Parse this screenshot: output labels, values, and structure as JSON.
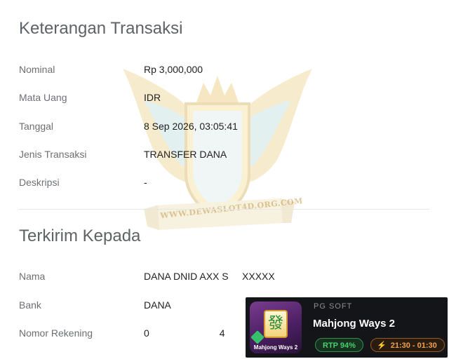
{
  "transaction": {
    "title": "Keterangan Transaksi",
    "rows": [
      {
        "label": "Nominal",
        "value": "Rp 3,000,000"
      },
      {
        "label": "Mata Uang",
        "value": "IDR"
      },
      {
        "label": "Tanggal",
        "value": "8 Sep 2026, 03:05:41"
      },
      {
        "label": "Jenis Transaksi",
        "value": "TRANSFER DANA"
      },
      {
        "label": "Deskripsi",
        "value": "-"
      }
    ]
  },
  "recipient": {
    "title": "Terkirim Kepada",
    "rows": [
      {
        "label": "Nama",
        "value": "DANA DNID AXX S     XXXXX"
      },
      {
        "label": "Bank",
        "value": "DANA"
      },
      {
        "label": "Nomor Rekening",
        "value_start": "0",
        "value_end": "4"
      }
    ]
  },
  "watermark": {
    "text": "WWW.DEWASLOT4D.ORG.COM",
    "emblem": "4D"
  },
  "game_card": {
    "provider": "PG SOFT",
    "title": "Mahjong Ways 2",
    "thumb_caption": "Mahjong Ways 2",
    "thumb_tile": "發",
    "rtp": "RTP 94%",
    "time": "21:30 - 01:30",
    "icon": "bolt-icon",
    "colors": {
      "card_bg": "#141519",
      "rtp_green": "#47d06f",
      "time_orange": "#f0a250"
    }
  }
}
